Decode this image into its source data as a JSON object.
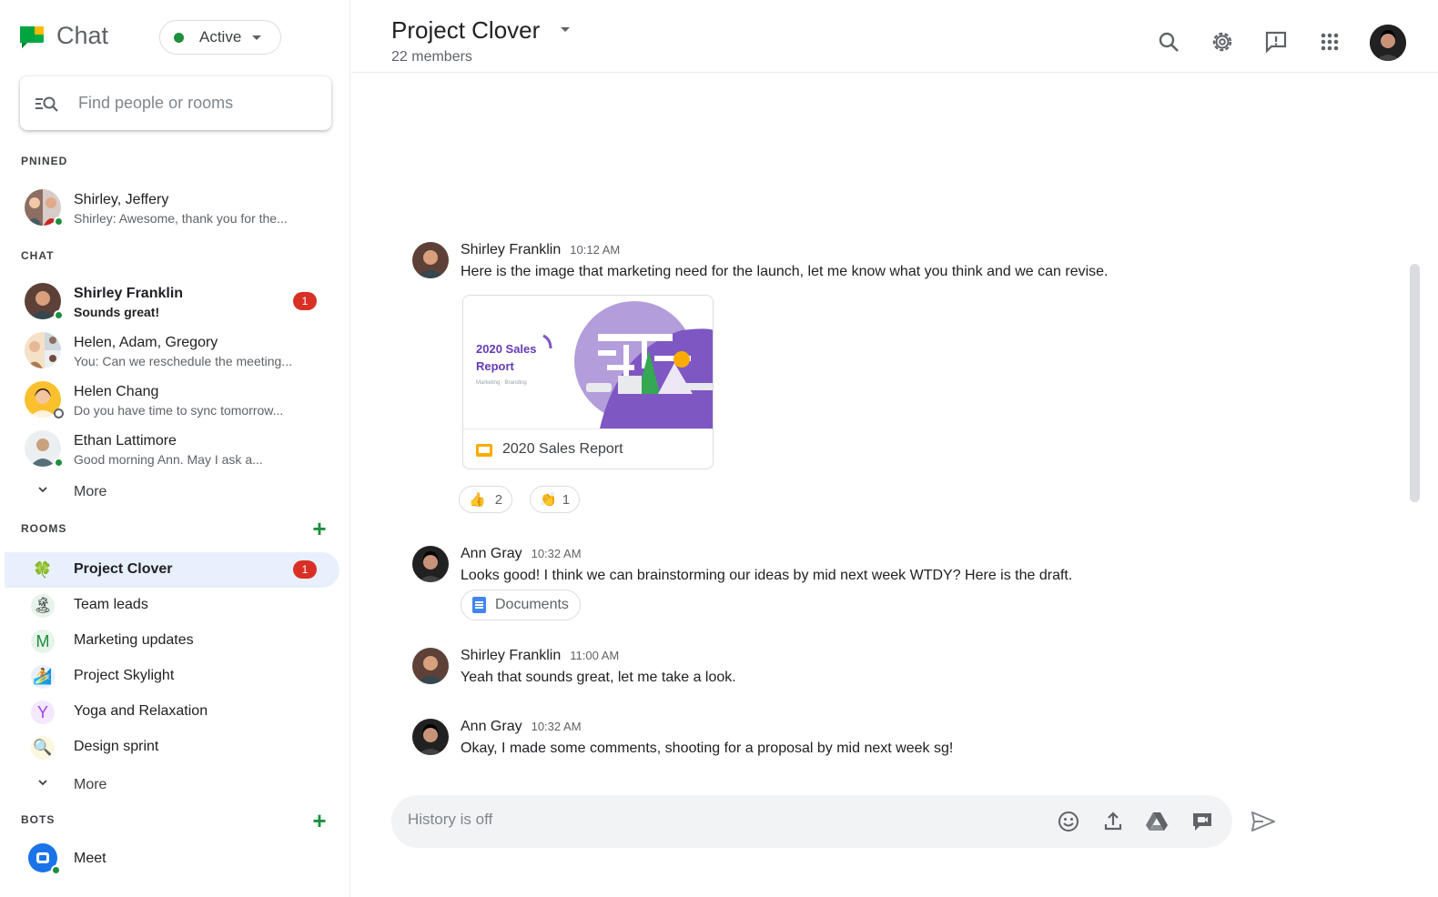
{
  "app": {
    "name": "Chat",
    "status": "Active"
  },
  "search": {
    "placeholder": "Find people or rooms"
  },
  "sections": {
    "pinned": "PNINED",
    "chat": "CHAT",
    "rooms": "ROOMS",
    "bots": "BOTS",
    "more": "More"
  },
  "pinned": [
    {
      "name": "Shirley, Jeffery",
      "preview": "Shirley: Awesome, thank you for the..."
    }
  ],
  "chats": [
    {
      "name": "Shirley Franklin",
      "preview": "Sounds great!",
      "badge": "1",
      "unread": true
    },
    {
      "name": "Helen, Adam, Gregory",
      "preview": "You: Can we reschedule the meeting..."
    },
    {
      "name": "Helen Chang",
      "preview": "Do you have time to sync tomorrow..."
    },
    {
      "name": "Ethan Lattimore",
      "preview": "Good morning Ann. May I ask a..."
    }
  ],
  "rooms": [
    {
      "name": "Project Clover",
      "icon": "🍀",
      "badge": "1",
      "active": true
    },
    {
      "name": "Team leads",
      "icon": "🏝"
    },
    {
      "name": "Marketing updates",
      "icon": "M"
    },
    {
      "name": "Project Skylight",
      "icon": "🏄"
    },
    {
      "name": "Yoga and Relaxation",
      "icon": "Y"
    },
    {
      "name": "Design sprint",
      "icon": "🔍"
    }
  ],
  "bots": [
    {
      "name": "Meet"
    }
  ],
  "header": {
    "title": "Project Clover",
    "members": "22 members"
  },
  "messages": [
    {
      "author": "Shirley Franklin",
      "time": "10:12 AM",
      "text": "Here is the image that marketing need for the launch, let me know what you think and we can revise."
    },
    {
      "author": "Ann Gray",
      "time": "10:32 AM",
      "text": "Looks good! I think we can brainstorming our ideas by mid next week WTDY? Here is the draft."
    },
    {
      "author": "Shirley Franklin",
      "time": "11:00 AM",
      "text": "Yeah that sounds great, let me take a look."
    },
    {
      "author": "Ann Gray",
      "time": "10:32 AM",
      "text": "Okay, I made some comments, shooting for a proposal by mid next week sg!"
    }
  ],
  "attachment": {
    "name": "2020 Sales Report",
    "thumb_title": "2020 Sales Report",
    "thumb_sub": "Marketing · Branding"
  },
  "reactions": [
    {
      "emoji": "👍",
      "count": "2"
    },
    {
      "emoji": "👏",
      "count": "1"
    }
  ],
  "doc_chip": {
    "label": "Documents"
  },
  "composer": {
    "placeholder": "History is off"
  },
  "colors": {
    "accent_green": "#1e8e3e",
    "badge_red": "#d93025",
    "active_room_bg": "#e8f0fe",
    "purple": "#673ab7"
  }
}
